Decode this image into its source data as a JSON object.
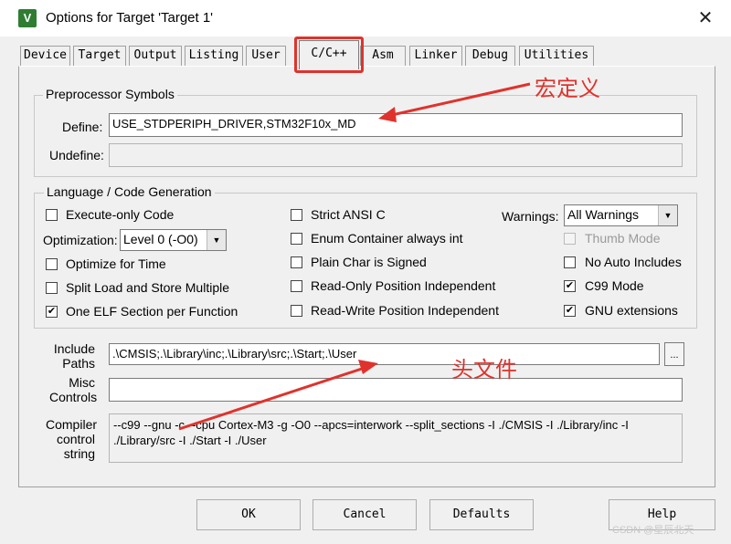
{
  "window": {
    "title": "Options for Target 'Target 1'",
    "icon_text": "V",
    "close_glyph": "✕"
  },
  "tabs": [
    {
      "label": "Device"
    },
    {
      "label": "Target"
    },
    {
      "label": "Output"
    },
    {
      "label": "Listing"
    },
    {
      "label": "User"
    },
    {
      "label": "C/C++"
    },
    {
      "label": "Asm"
    },
    {
      "label": "Linker"
    },
    {
      "label": "Debug"
    },
    {
      "label": "Utilities"
    }
  ],
  "active_tab": "C/C++",
  "preprocessor": {
    "group_title": "Preprocessor Symbols",
    "define_label": "Define:",
    "define_value": "USE_STDPERIPH_DRIVER,STM32F10x_MD",
    "undefine_label": "Undefine:",
    "undefine_value": ""
  },
  "language": {
    "group_title": "Language / Code Generation",
    "execute_only": {
      "label": "Execute-only Code",
      "checked": false
    },
    "optimization_label": "Optimization:",
    "optimization_value": "Level 0 (-O0)",
    "optimize_time": {
      "label": "Optimize for Time",
      "checked": false
    },
    "split_load": {
      "label": "Split Load and Store Multiple",
      "checked": false
    },
    "one_elf": {
      "label": "One ELF Section per Function",
      "checked": true
    },
    "strict_ansi": {
      "label": "Strict ANSI C",
      "checked": false
    },
    "enum_container": {
      "label": "Enum Container always int",
      "checked": false
    },
    "plain_char": {
      "label": "Plain Char is Signed",
      "checked": false
    },
    "ro_pi": {
      "label": "Read-Only Position Independent",
      "checked": false
    },
    "rw_pi": {
      "label": "Read-Write Position Independent",
      "checked": false
    },
    "warnings_label": "Warnings:",
    "warnings_value": "All Warnings",
    "thumb_mode": {
      "label": "Thumb Mode",
      "checked": false,
      "disabled": true
    },
    "no_auto_includes": {
      "label": "No Auto Includes",
      "checked": false
    },
    "c99_mode": {
      "label": "C99 Mode",
      "checked": true
    },
    "gnu_extensions": {
      "label": "GNU extensions",
      "checked": true
    }
  },
  "include_paths": {
    "label_line1": "Include",
    "label_line2": "Paths",
    "value": ".\\CMSIS;.\\Library\\inc;.\\Library\\src;.\\Start;.\\User",
    "browse_glyph": "..."
  },
  "misc_controls": {
    "label_line1": "Misc",
    "label_line2": "Controls",
    "value": ""
  },
  "compiler_control": {
    "label_line1": "Compiler",
    "label_line2": "control",
    "label_line3": "string",
    "line1": "--c99 --gnu -c --cpu Cortex-M3 -g -O0 --apcs=interwork --split_sections -I ./CMSIS -I ./Library/inc -I",
    "line2": "./Library/src -I ./Start -I ./User"
  },
  "buttons": {
    "ok": "OK",
    "cancel": "Cancel",
    "defaults": "Defaults",
    "help": "Help"
  },
  "annotations": {
    "macro_definition": "宏定义",
    "header_files": "头文件",
    "color": "#e0322c",
    "highlight_color": "#e0322c"
  },
  "watermark": "CSDN @星辰北天"
}
